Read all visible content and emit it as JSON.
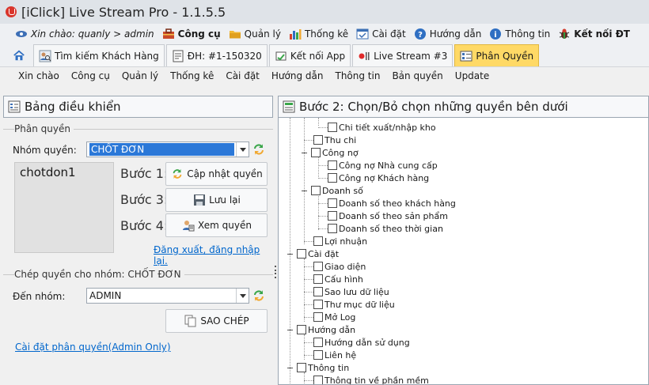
{
  "window": {
    "title": "[iClick] Live Stream Pro - 1.1.5.5"
  },
  "menubar1": {
    "greeting": "Xin chào: quanly > admin",
    "items": [
      {
        "label": "Công cụ",
        "icon": "toolbox-icon"
      },
      {
        "label": "Quản lý",
        "icon": "folder-icon"
      },
      {
        "label": "Thống kê",
        "icon": "bar-chart-icon"
      },
      {
        "label": "Cài đặt",
        "icon": "settings-icon"
      },
      {
        "label": "Hướng dẫn",
        "icon": "help-icon"
      },
      {
        "label": "Thông tin",
        "icon": "info-icon"
      },
      {
        "label": "Kết nối ĐT",
        "icon": "phone-bug-icon"
      }
    ]
  },
  "tabs": [
    {
      "label": "Tìm kiếm Khách Hàng",
      "icon": "customer-search-icon"
    },
    {
      "label": "ĐH: #1-150320",
      "icon": "order-icon"
    },
    {
      "label": "Kết nối App",
      "icon": "connect-app-icon"
    },
    {
      "label": "Live Stream #3",
      "icon": "live-icon"
    },
    {
      "label": "Phân Quyền",
      "icon": "permission-icon",
      "active": true
    }
  ],
  "menubar2": [
    "Xin chào",
    "Công cụ",
    "Quản lý",
    "Thống kê",
    "Cài đặt",
    "Hướng dẫn",
    "Thông tin",
    "Bản quyền",
    "Update"
  ],
  "left": {
    "title": "Bảng điều khiển",
    "group1": "Phân quyền",
    "group_label": "Nhóm quyền:",
    "group_value": "CHỐT ĐƠN",
    "list_item": "chotdon1",
    "step1": "Bước 1:",
    "step3": "Bước 3:",
    "step4": "Bước 4:",
    "btn_update": "Cập nhật quyền",
    "btn_save": "Lưu lại",
    "btn_view": "Xem quyền",
    "logout_link": "Đăng xuất, đăng nhập lại.",
    "group2": "Chép quyền cho nhóm: CHỐT ĐƠN",
    "to_group_label": "Đến nhóm:",
    "to_group_value": "ADMIN",
    "btn_copy": "SAO CHÉP",
    "admin_link": "Cài đặt phân quyền(Admin Only)"
  },
  "right": {
    "title": "Bước 2: Chọn/Bỏ chọn những quyền bên dưới",
    "tree": [
      {
        "label": "Chi tiết xuất/nhập kho"
      },
      {
        "label": "Thu chi"
      },
      {
        "label": "Công nợ"
      },
      {
        "label": "Công nợ Nhà cung cấp"
      },
      {
        "label": "Công nợ Khách hàng"
      },
      {
        "label": "Doanh số"
      },
      {
        "label": "Doanh số theo khách hàng"
      },
      {
        "label": "Doanh số theo sản phẩm"
      },
      {
        "label": "Doanh số theo thời gian"
      },
      {
        "label": "Lợi nhuận"
      },
      {
        "label": "Cài đặt"
      },
      {
        "label": "Giao diện"
      },
      {
        "label": "Cấu hình"
      },
      {
        "label": "Sao lưu dữ liệu"
      },
      {
        "label": "Thư mục dữ liệu"
      },
      {
        "label": "Mở Log"
      },
      {
        "label": "Hướng dẫn"
      },
      {
        "label": "Hướng dẫn sử dụng"
      },
      {
        "label": "Liên hệ"
      },
      {
        "label": "Thông tin"
      },
      {
        "label": "Thông tin về phần mềm"
      }
    ]
  }
}
